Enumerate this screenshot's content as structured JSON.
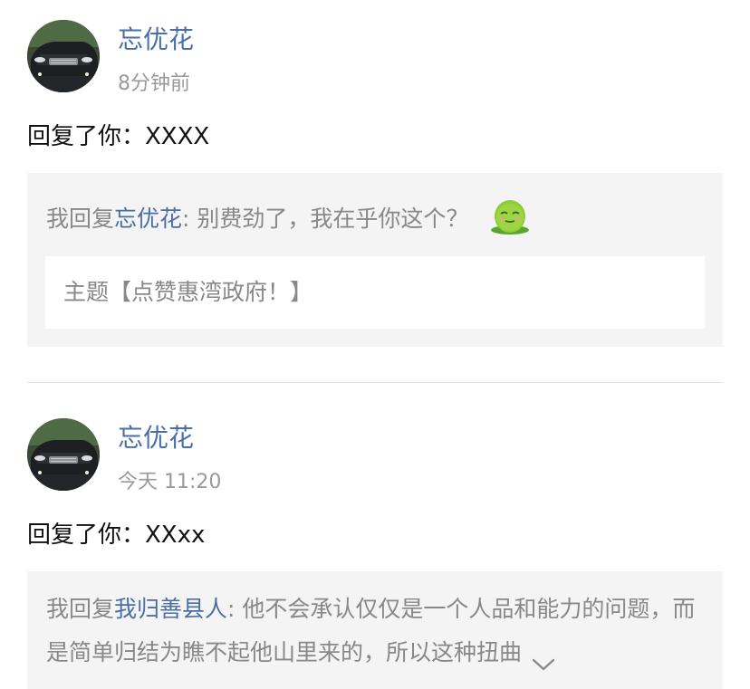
{
  "replies": [
    {
      "user_name": "忘优花",
      "time": "8分钟前",
      "reply_text": "回复了你：XXXX",
      "quote": {
        "prefix": "我回复",
        "quoted_user": "忘优花",
        "text": ": 别费劲了，我在乎你这个？",
        "emoji": "green-bean-emoji",
        "topic": "主题【点赞惠湾政府！】"
      }
    },
    {
      "user_name": "忘优花",
      "time": "今天 11:20",
      "reply_text": "回复了你：XXxx",
      "quote": {
        "prefix": "我回复",
        "quoted_user": "我归善县人",
        "text": ": 他不会承认仅仅是一个人品和能力的问题，而是简单归结为瞧不起他山里来的，所以这种扭曲",
        "expand_icon": "chevron-down-icon"
      }
    }
  ],
  "colors": {
    "link": "#4a6fa5",
    "muted": "#999999",
    "quote_bg": "#f4f4f4",
    "divider": "#e2e2e2"
  }
}
